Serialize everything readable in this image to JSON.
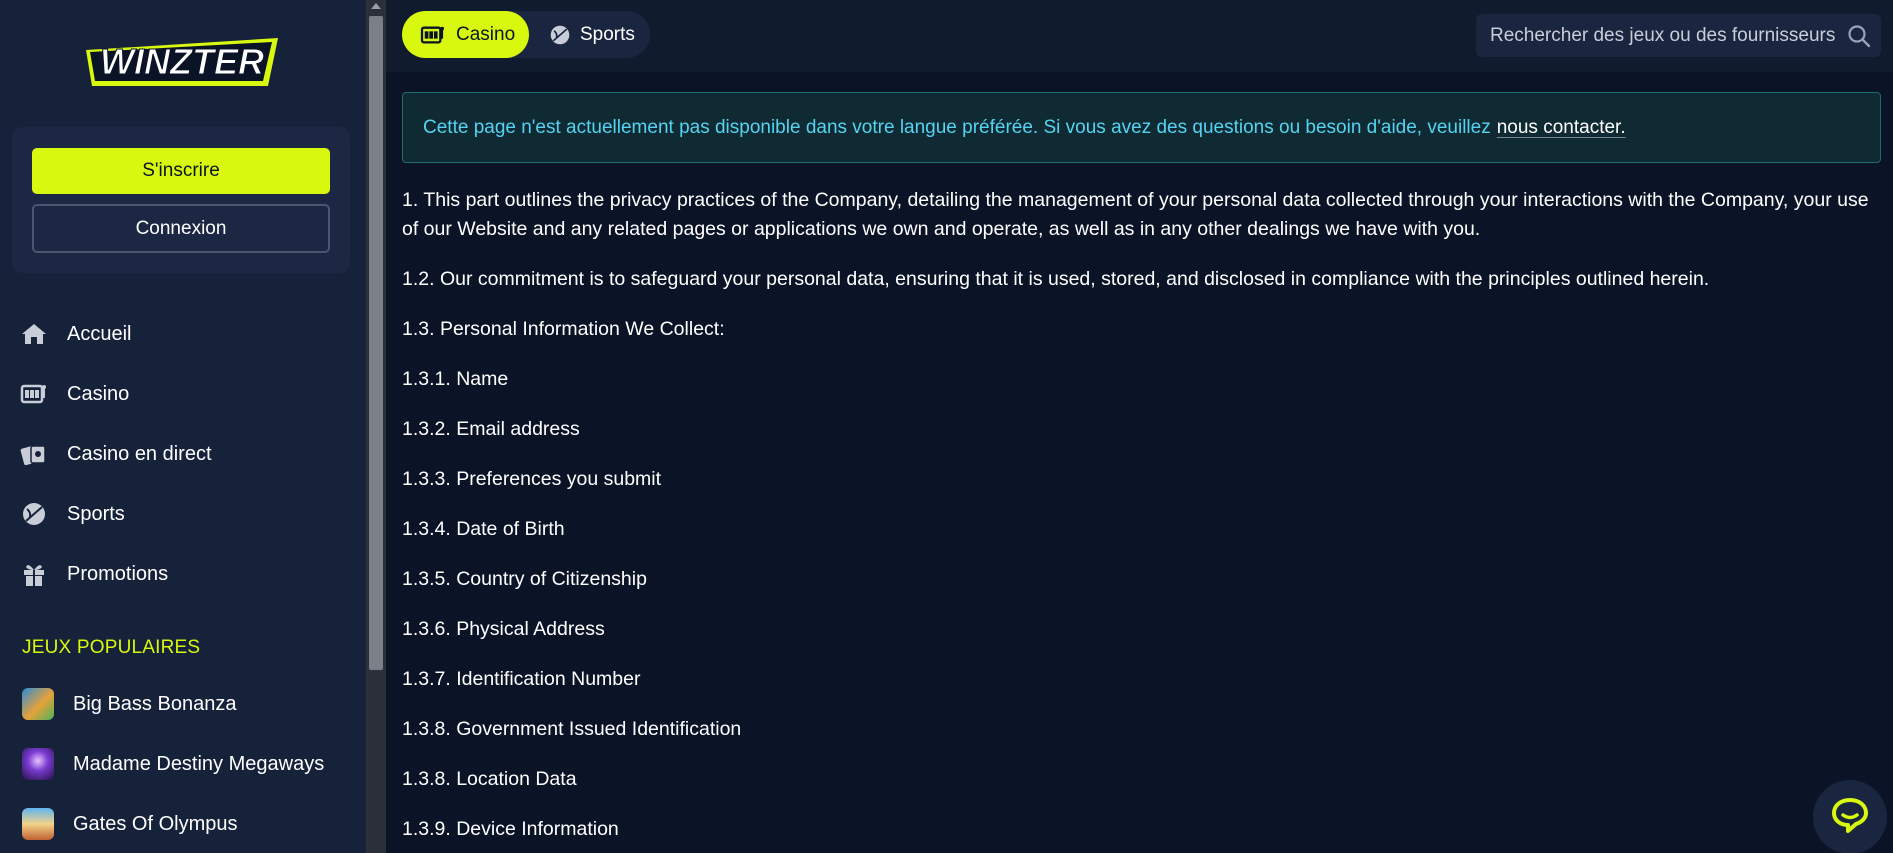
{
  "sidebar": {
    "logo_text": "WINZTER",
    "signup_label": "S'inscrire",
    "login_label": "Connexion",
    "nav": [
      {
        "label": "Accueil",
        "icon": "home-icon"
      },
      {
        "label": "Casino",
        "icon": "slot-machine-icon"
      },
      {
        "label": "Casino en direct",
        "icon": "cards-icon"
      },
      {
        "label": "Sports",
        "icon": "ball-icon"
      },
      {
        "label": "Promotions",
        "icon": "gift-icon"
      }
    ],
    "popular_heading": "JEUX POPULAIRES",
    "games": [
      {
        "label": "Big Bass Bonanza"
      },
      {
        "label": "Madame Destiny Megaways"
      },
      {
        "label": "Gates Of Olympus"
      }
    ]
  },
  "topbar": {
    "tabs": [
      {
        "label": "Casino",
        "active": true
      },
      {
        "label": "Sports",
        "active": false
      }
    ],
    "search_placeholder": "Rechercher des jeux ou des fournisseurs"
  },
  "notice": {
    "text": "Cette page n'est actuellement pas disponible dans votre langue préférée. Si vous avez des questions ou besoin d'aide, veuillez",
    "link": "nous contacter."
  },
  "content": {
    "paragraphs": [
      "1. This part outlines the privacy practices of the Company, detailing the management of your personal data collected through your interactions with the Company, your use of our Website and any related pages or applications we own and operate, as well as in any other dealings we have with you.",
      "1.2. Our commitment is to safeguard your personal data, ensuring that it is used, stored, and disclosed in compliance with the principles outlined herein.",
      "1.3. Personal Information We Collect:",
      "1.3.1. Name",
      "1.3.2. Email address",
      "1.3.3. Preferences you submit",
      "1.3.4. Date of Birth",
      "1.3.5. Country of Citizenship",
      "1.3.6. Physical Address",
      "1.3.7. Identification Number",
      "1.3.8. Government Issued Identification",
      "1.3.8. Location Data",
      "1.3.9. Device Information"
    ]
  },
  "colors": {
    "accent": "#d9f80f",
    "background": "#0b1426",
    "sidebar": "#16213a",
    "notice_text": "#55d3f0"
  }
}
